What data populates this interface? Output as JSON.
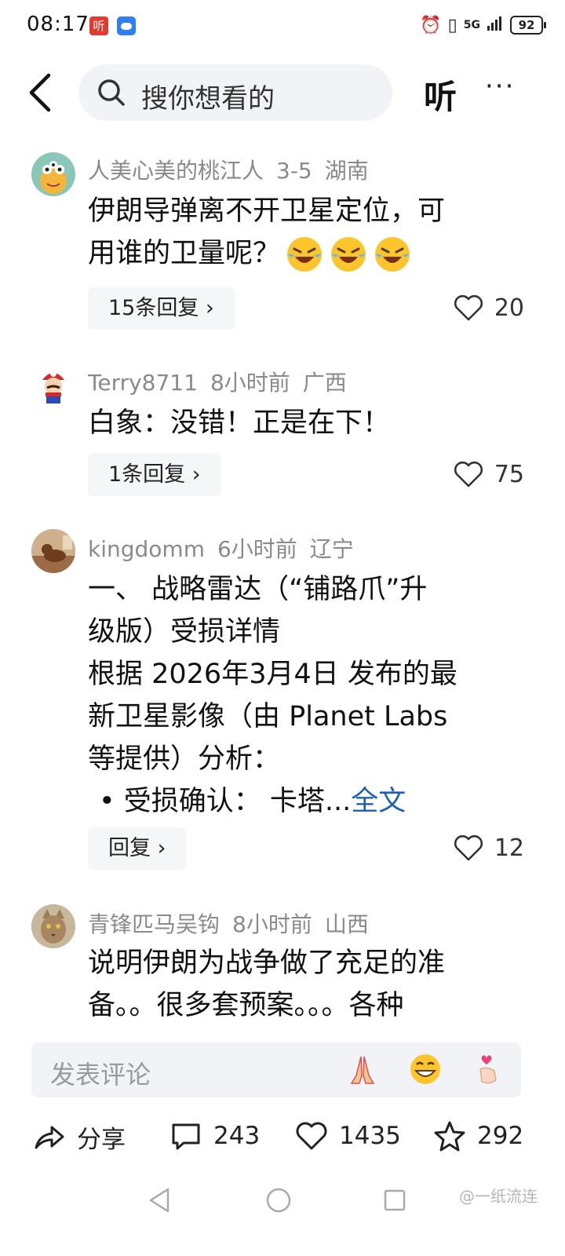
{
  "status_bar": {
    "time": "08:17",
    "app_badge_1": "听",
    "battery": "92",
    "network": "5G"
  },
  "header": {
    "search_placeholder": "搜你想看的",
    "listen_label": "听",
    "more_label": "···"
  },
  "comments": [
    {
      "author": "人美心美的桃江人",
      "time": "3-5",
      "region": "湖南",
      "text_line1": "伊朗导弹离不开卫星定位，可",
      "text_line2": "用谁的卫量呢？",
      "reply_label": "15条回复 ›",
      "likes": "20"
    },
    {
      "author": "Terry8711",
      "time": "8小时前",
      "region": "广西",
      "text_line1": "白象：没错！正是在下！",
      "reply_label": "1条回复 ›",
      "likes": "75"
    },
    {
      "author": "kingdomm",
      "time": "6小时前",
      "region": "辽宁",
      "text_lines": [
        "一、 战略雷达（“铺路爪”升",
        "级版）受损详情",
        "根据 2026年3月4日 发布的最",
        "新卫星影像（由 Planet Labs",
        "等提供）分析："
      ],
      "bullet_text": "•  受损确认：  卡塔...",
      "full_text_link": "全文",
      "reply_label": "回复 ›",
      "likes": "12"
    },
    {
      "author": "青锋匹马吴钩",
      "time": "8小时前",
      "region": "山西",
      "text_lines": [
        "说明伊朗为战争做了充足的准",
        "备。。很多套预案。。。各种"
      ]
    }
  ],
  "comment_bar": {
    "placeholder": "发表评论"
  },
  "action_bar": {
    "share_label": "分享",
    "comment_count": "243",
    "like_count": "1435",
    "favorite_count": "292"
  },
  "watermark": "@一纸流连",
  "colors": {
    "link": "#1b5fb8",
    "meta_text": "#8a8a8a",
    "search_bg": "#f2f3f6"
  }
}
